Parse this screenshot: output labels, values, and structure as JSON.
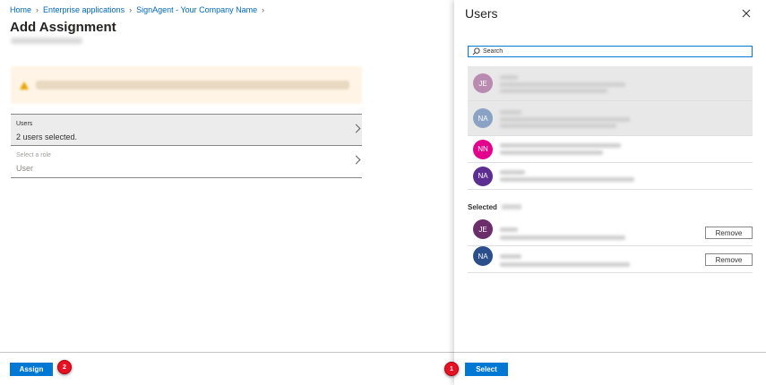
{
  "breadcrumb": {
    "home": "Home",
    "enterprise_apps": "Enterprise applications",
    "app": "SignAgent - Your Company Name"
  },
  "page": {
    "title": "Add Assignment"
  },
  "users_row": {
    "label": "Users",
    "value": "2 users selected."
  },
  "role_row": {
    "label": "Select a role",
    "value": "User"
  },
  "buttons": {
    "assign": "Assign",
    "select": "Select",
    "remove": "Remove"
  },
  "markers": {
    "assign_step": "2",
    "select_step": "1"
  },
  "users_panel": {
    "title": "Users",
    "search_placeholder": "Search",
    "users": [
      {
        "initials": "JE",
        "color": "#b98bb0",
        "selected": true
      },
      {
        "initials": "NA",
        "color": "#8aa2c4",
        "selected": true
      },
      {
        "initials": "NN",
        "color": "#e3008c",
        "selected": false
      },
      {
        "initials": "NA",
        "color": "#5c2e91",
        "selected": false
      }
    ],
    "selected_label": "Selected",
    "selected_users": [
      {
        "initials": "JE",
        "color": "#6b2e6b"
      },
      {
        "initials": "NA",
        "color": "#2b4f8a"
      }
    ]
  },
  "colors": {
    "accent": "#0078d4",
    "link": "#0067b8",
    "marker": "#e81123"
  }
}
